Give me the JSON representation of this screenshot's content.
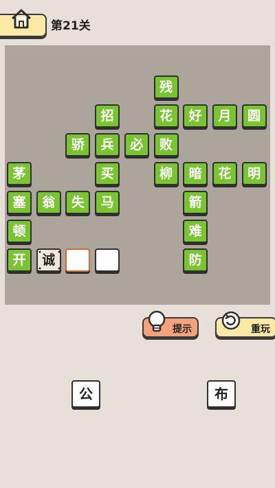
{
  "header": {
    "level_label": "第21关",
    "home_icon": "home-icon"
  },
  "board": {
    "tiles": [
      {
        "t": "残",
        "c": 5,
        "r": 0
      },
      {
        "t": "招",
        "c": 3,
        "r": 1
      },
      {
        "t": "花",
        "c": 5,
        "r": 1
      },
      {
        "t": "好",
        "c": 6,
        "r": 1
      },
      {
        "t": "月",
        "c": 7,
        "r": 1
      },
      {
        "t": "圆",
        "c": 8,
        "r": 1
      },
      {
        "t": "骄",
        "c": 2,
        "r": 2
      },
      {
        "t": "兵",
        "c": 3,
        "r": 2
      },
      {
        "t": "必",
        "c": 4,
        "r": 2
      },
      {
        "t": "败",
        "c": 5,
        "r": 2
      },
      {
        "t": "茅",
        "c": 0,
        "r": 3
      },
      {
        "t": "买",
        "c": 3,
        "r": 3
      },
      {
        "t": "柳",
        "c": 5,
        "r": 3
      },
      {
        "t": "暗",
        "c": 6,
        "r": 3
      },
      {
        "t": "花",
        "c": 7,
        "r": 3
      },
      {
        "t": "明",
        "c": 8,
        "r": 3
      },
      {
        "t": "塞",
        "c": 0,
        "r": 4
      },
      {
        "t": "翁",
        "c": 1,
        "r": 4
      },
      {
        "t": "失",
        "c": 2,
        "r": 4
      },
      {
        "t": "马",
        "c": 3,
        "r": 4
      },
      {
        "t": "箭",
        "c": 6,
        "r": 4
      },
      {
        "t": "顿",
        "c": 0,
        "r": 5
      },
      {
        "t": "难",
        "c": 6,
        "r": 5
      },
      {
        "t": "开",
        "c": 0,
        "r": 6
      },
      {
        "t": "诚",
        "c": 1,
        "r": 6,
        "kind": "given"
      },
      {
        "t": "",
        "c": 2,
        "r": 6,
        "kind": "blank",
        "selected": true
      },
      {
        "t": "",
        "c": 3,
        "r": 6,
        "kind": "blank"
      },
      {
        "t": "防",
        "c": 6,
        "r": 6
      }
    ]
  },
  "buttons": {
    "hint": {
      "label": "提示",
      "icon": "lightbulb-icon"
    },
    "reset": {
      "label": "重玩",
      "icon": "refresh-icon"
    }
  },
  "choices": [
    {
      "t": "公"
    },
    {
      "t": "布"
    }
  ],
  "colors": {
    "tile_green": "#79c530",
    "board": "#aca59b",
    "background": "#e7e0d8",
    "selected_border": "#e0682b"
  }
}
